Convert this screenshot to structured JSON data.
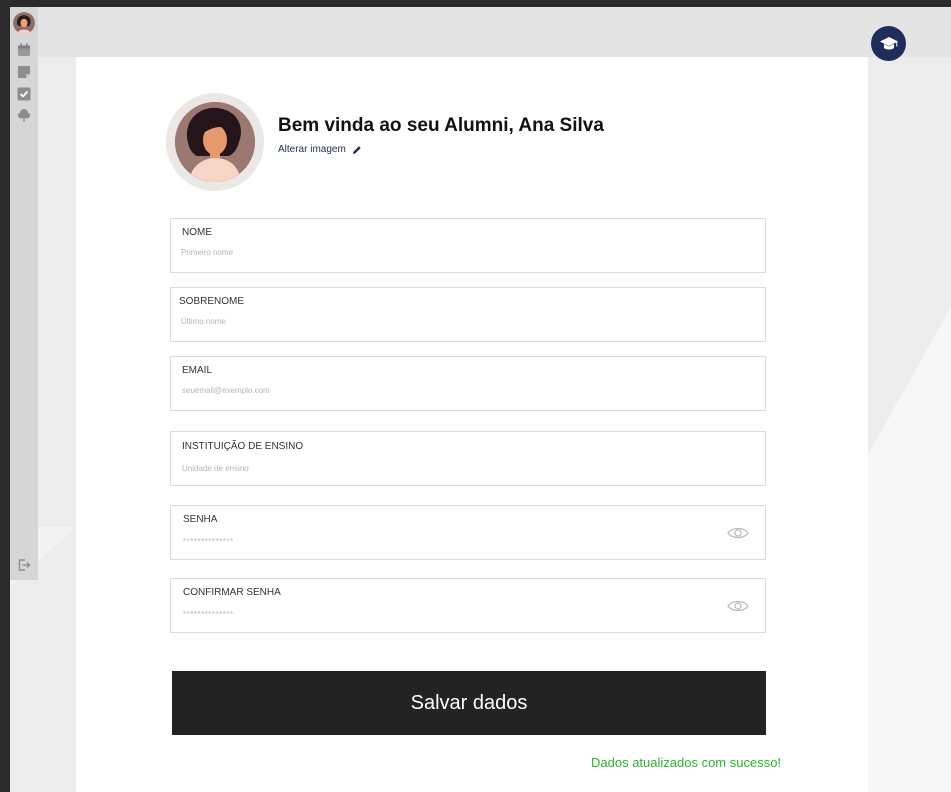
{
  "header": {
    "welcome": "Bem vinda ao seu Alumni, Ana Silva",
    "change_image": "Alterar imagem"
  },
  "sidebar": {
    "items": [
      "avatar-icon",
      "calendar-icon",
      "notes-icon",
      "checkbox-icon",
      "tree-icon"
    ],
    "logout_icon": "logout-icon"
  },
  "badge_icon": "graduation-cap-icon",
  "form": {
    "fields": [
      {
        "label": "NOME",
        "placeholder": "Primeiro nome"
      },
      {
        "label": "SOBRENOME",
        "placeholder": "Último nome"
      },
      {
        "label": "EMAIL",
        "placeholder": "seuemail@exemplo.com"
      },
      {
        "label": "INSTITUIÇÃO DE ENSINO",
        "placeholder": "Unidade de ensino"
      },
      {
        "label": "SENHA",
        "placeholder": "**************"
      },
      {
        "label": "CONFIRMAR SENHA",
        "placeholder": "**************"
      }
    ],
    "save_label": "Salvar dados",
    "success_message": "Dados atualizados com sucesso!"
  },
  "colors": {
    "primary_dark": "#232323",
    "brand_navy": "#1f2d5a",
    "success_green": "#2bb52b"
  }
}
